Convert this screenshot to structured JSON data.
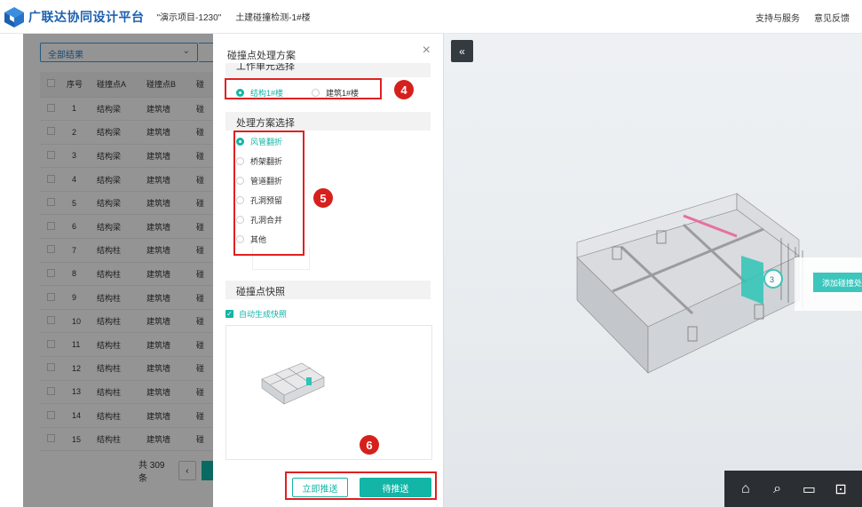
{
  "header": {
    "brand": "广联达协同设计平台",
    "project": "\"演示项目-1230\"",
    "subtitle": "土建碰撞检测-1#楼",
    "links": [
      "支持与服务",
      "意见反馈"
    ]
  },
  "left_panel": {
    "filter_value": "全部结果",
    "columns": [
      "序号",
      "碰撞点A",
      "碰撞点B",
      "碰"
    ],
    "rows": [
      {
        "no": "1",
        "a": "结构梁",
        "b": "建筑墙",
        "c": "碰"
      },
      {
        "no": "2",
        "a": "结构梁",
        "b": "建筑墙",
        "c": "碰"
      },
      {
        "no": "3",
        "a": "结构梁",
        "b": "建筑墙",
        "c": "碰"
      },
      {
        "no": "4",
        "a": "结构梁",
        "b": "建筑墙",
        "c": "碰"
      },
      {
        "no": "5",
        "a": "结构梁",
        "b": "建筑墙",
        "c": "碰"
      },
      {
        "no": "6",
        "a": "结构梁",
        "b": "建筑墙",
        "c": "碰"
      },
      {
        "no": "7",
        "a": "结构柱",
        "b": "建筑墙",
        "c": "碰"
      },
      {
        "no": "8",
        "a": "结构柱",
        "b": "建筑墙",
        "c": "碰"
      },
      {
        "no": "9",
        "a": "结构柱",
        "b": "建筑墙",
        "c": "碰"
      },
      {
        "no": "10",
        "a": "结构柱",
        "b": "建筑墙",
        "c": "碰"
      },
      {
        "no": "11",
        "a": "结构柱",
        "b": "建筑墙",
        "c": "碰"
      },
      {
        "no": "12",
        "a": "结构柱",
        "b": "建筑墙",
        "c": "碰"
      },
      {
        "no": "13",
        "a": "结构柱",
        "b": "建筑墙",
        "c": "碰"
      },
      {
        "no": "14",
        "a": "结构柱",
        "b": "建筑墙",
        "c": "碰"
      },
      {
        "no": "15",
        "a": "结构柱",
        "b": "建筑墙",
        "c": "碰"
      }
    ],
    "total": "共 309 条",
    "prev": "‹"
  },
  "panel": {
    "title": "碰撞点处理方案",
    "close": "×",
    "section_work_unit": "工作单元选择",
    "work_units": [
      {
        "label": "结构1#楼",
        "selected": true
      },
      {
        "label": "建筑1#楼",
        "selected": false
      }
    ],
    "section_plan": "处理方案选择",
    "plans": [
      {
        "label": "风管翻折",
        "selected": true
      },
      {
        "label": "桥架翻折",
        "selected": false
      },
      {
        "label": "管道翻折",
        "selected": false
      },
      {
        "label": "孔洞预留",
        "selected": false
      },
      {
        "label": "孔洞合并",
        "selected": false
      },
      {
        "label": "其他",
        "selected": false
      }
    ],
    "section_snapshot": "碰撞点快照",
    "auto_snapshot": "自动生成快照",
    "btn_push_now": "立即推送",
    "btn_pending": "待推送"
  },
  "annotations": {
    "b4": "4",
    "b5": "5",
    "b6": "6"
  },
  "viewer": {
    "collapse": "«",
    "marker": "3",
    "add_button": "添加碰撞处理",
    "toolbar": [
      "home-icon",
      "zoom-window-icon",
      "measure-icon",
      "section-icon"
    ]
  },
  "colors": {
    "accent": "#12b5a6",
    "annotation": "#e02020",
    "brand": "#1d5fb0"
  }
}
